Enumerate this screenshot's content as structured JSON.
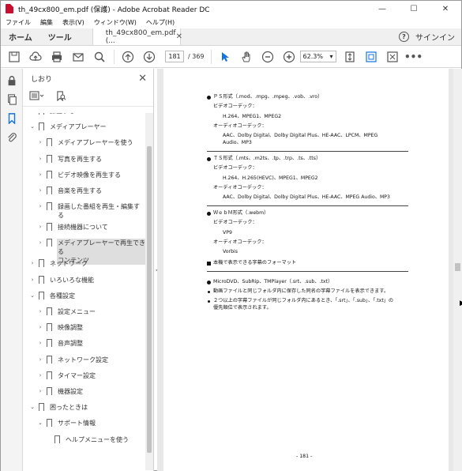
{
  "window": {
    "title": "th_49cx800_em.pdf (保護) - Adobe Acrobat Reader DC"
  },
  "menu": [
    "ファイル",
    "編集",
    "表示(V)",
    "ウィンドウ(W)",
    "ヘルプ(H)"
  ],
  "tabs": {
    "home": "ホーム",
    "tools": "ツール",
    "doc": "th_49cx800_em.pdf (...",
    "signin": "サインイン"
  },
  "toolbar": {
    "page_current": "181",
    "page_total": "/ 369",
    "zoom": "62.3%"
  },
  "panel": {
    "title": "しおり"
  },
  "tree": [
    {
      "label": "録画する",
      "chev": "›",
      "level": 0
    },
    {
      "label": "メディアプレーヤー",
      "chev": "⌄",
      "level": 0
    },
    {
      "label": "メディアプレーヤーを使う",
      "chev": "›",
      "level": 1
    },
    {
      "label": "写真を再生する",
      "chev": "›",
      "level": 1
    },
    {
      "label": "ビデオ映像を再生する",
      "chev": "›",
      "level": 1
    },
    {
      "label": "音楽を再生する",
      "chev": "›",
      "level": 1
    },
    {
      "label": "録画した番組を再生・編集す",
      "label2": "る",
      "chev": "›",
      "level": 1
    },
    {
      "label": "接続機器について",
      "chev": "›",
      "level": 1
    },
    {
      "label": "メディアプレーヤーで再生できる",
      "label2": "コンテンツ",
      "chev": "›",
      "level": 1,
      "selected": true
    },
    {
      "label": "ネットワーク",
      "chev": "›",
      "level": 0
    },
    {
      "label": "いろいろな機能",
      "chev": "›",
      "level": 0
    },
    {
      "label": "各種設定",
      "chev": "⌄",
      "level": 0
    },
    {
      "label": "設定メニュー",
      "chev": "›",
      "level": 1
    },
    {
      "label": "映像調整",
      "chev": "›",
      "level": 1
    },
    {
      "label": "音声調整",
      "chev": "›",
      "level": 1
    },
    {
      "label": "ネットワーク設定",
      "chev": "›",
      "level": 1
    },
    {
      "label": "タイマー設定",
      "chev": "›",
      "level": 1
    },
    {
      "label": "機器設定",
      "chev": "›",
      "level": 1
    },
    {
      "label": "困ったときは",
      "chev": "⌄",
      "level": 0
    },
    {
      "label": "サポート情報",
      "chev": "⌄",
      "level": 1
    },
    {
      "label": "ヘルプメニューを使う",
      "chev": "",
      "level": 2
    }
  ],
  "doc": {
    "ps_title": "ＰＳ形式（.mod、.mpg、.mpeg、.vob、.vro）",
    "ps_video_label": "ビデオコーデック：",
    "ps_video": "H.264、MPEG1、MPEG2",
    "ps_audio_label": "オーディオコーデック：",
    "ps_audio1": "AAC、Dolby Digital、Dolby Digital Plus、HE-AAC、LPCM、MPEG",
    "ps_audio2": "Audio、MP3",
    "ts_title": "ＴＳ形式（.mts、.m2ts、.tp、.trp、.ts、.tts）",
    "ts_video_label": "ビデオコーデック：",
    "ts_video": "H.264、H.265(HEVC)、MPEG1、MPEG2",
    "ts_audio_label": "オーディオコーデック：",
    "ts_audio": "AAC、Dolby Digital、Dolby Digital Plus、HE-AAC、MPEG Audio、MP3",
    "webm_title": "ＷｅｂＭ形式（.webm）",
    "webm_video_label": "ビデオコーデック：",
    "webm_video": "VP9",
    "webm_audio_label": "オーディオコーデック：",
    "webm_audio": "Vorbis",
    "subtitle_heading": "本機で表示できる字幕のフォーマット",
    "sub_formats": "MicroDVD、SubRip、TMPlayer（.srt、.sub、.txt）",
    "note1": "動画ファイルと同じフォルダ内に保存した同名の字幕ファイルを表示できます。",
    "note2a": "２つ以上の字幕ファイルが同じフォルダ内にあるとき、「.srt」、「.sub」、「.txt」の",
    "note2b": "優先順位で表示されます。",
    "page_number": "- 181 -"
  }
}
